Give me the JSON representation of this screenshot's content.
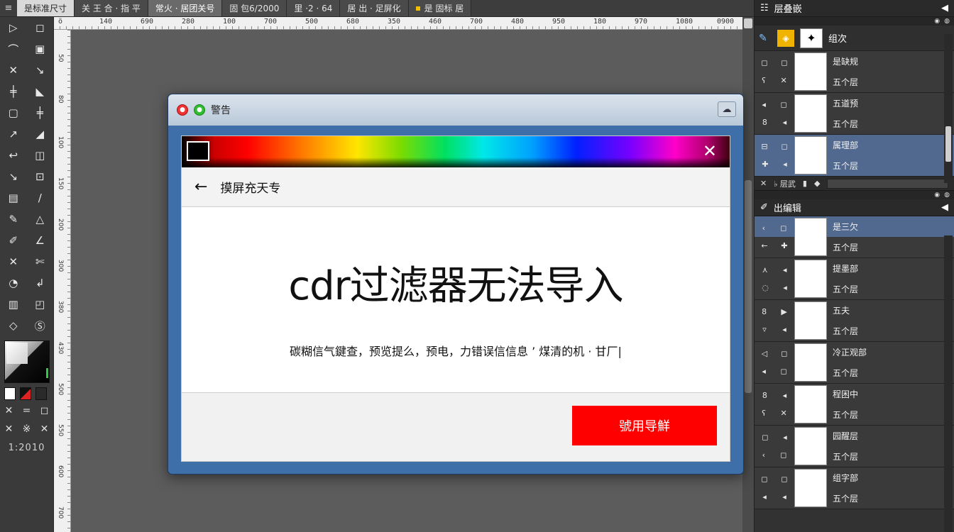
{
  "tabs": {
    "menu_icon": "≡",
    "items": [
      {
        "label": "是标准尺寸",
        "state": "first"
      },
      {
        "label": "关 王  合  ·  指 平",
        "state": "normal"
      },
      {
        "label": "常火  ·  居团关号",
        "state": "active"
      },
      {
        "label": "固 包6/2000",
        "state": "normal"
      },
      {
        "label": "里 ·2  ·  64",
        "state": "normal"
      },
      {
        "label": "居 出 ·  足屏化",
        "state": "normal"
      },
      {
        "label": "是 固标  居",
        "state": "dot"
      }
    ]
  },
  "ruler": {
    "top_labels": [
      "ö",
      "140",
      "690",
      "280",
      "100",
      "700",
      "500",
      "680",
      "350",
      "460",
      "700",
      "480",
      "950",
      "180",
      "970",
      "1080",
      "0900"
    ],
    "left_labels": [
      "50",
      "80",
      "100",
      "150",
      "200",
      "300",
      "380",
      "430",
      "500",
      "550",
      "600",
      "700"
    ]
  },
  "toolbox": {
    "tools": [
      [
        "▷",
        "◻"
      ],
      [
        "⌒",
        "▣"
      ],
      [
        "✕",
        "↘"
      ],
      [
        "╪",
        "◣"
      ],
      [
        "▢",
        "╪"
      ],
      [
        "↗",
        "◢"
      ],
      [
        "↩",
        "◫"
      ],
      [
        "↘",
        "⊡"
      ],
      [
        "▤",
        "∕"
      ],
      [
        "✎",
        "△"
      ],
      [
        "✐",
        "∠"
      ],
      [
        "✕",
        "✄"
      ],
      [
        "◔",
        "↲"
      ],
      [
        "▥",
        "◰"
      ],
      [
        "◇",
        "Ⓢ"
      ]
    ],
    "small_row_1": [
      "✕",
      "=",
      "◻"
    ],
    "small_row_2": [
      "✕",
      "※",
      "✕"
    ],
    "readout": "1:2010"
  },
  "dialog": {
    "title": "警告",
    "help_icon": "☁",
    "close_glyph": "✕",
    "back_glyph": "←",
    "nav_title": "摸屏充天专",
    "headline": "cdr过滤器无法导入",
    "message": "碳糊信气鍵查，预览提么，预电，力错误信信息  ’  煤清的机 · 甘厂|",
    "action_label": "號用导鮮"
  },
  "panels": {
    "layers_title": "层叠嵌",
    "channels_title": "出编辑",
    "top_layer_label": "组次",
    "layers": [
      {
        "labels": [
          "是缺规",
          "五个层"
        ],
        "ctrls": [
          [
            "◻",
            "◻"
          ],
          [
            "ʕ",
            "✕"
          ]
        ],
        "selected": false
      },
      {
        "labels": [
          "五道预",
          "五个层"
        ],
        "ctrls": [
          [
            "◂",
            "◻"
          ],
          [
            "8",
            "◂"
          ]
        ],
        "selected": false
      },
      {
        "labels": [
          "属理部",
          "五个层"
        ],
        "ctrls": [
          [
            "⊟",
            "◻"
          ],
          [
            "✚",
            "◂"
          ]
        ],
        "selected": true
      }
    ],
    "toolbar": [
      "✕",
      "♭ 层武",
      "▮",
      "◆"
    ],
    "channels": [
      {
        "labels": [
          "是三欠",
          "五个层"
        ],
        "ctrls": [
          [
            "‹",
            "◻"
          ],
          [
            "←",
            "✚"
          ]
        ],
        "half": true
      },
      {
        "labels": [
          "提墨部",
          "五个层"
        ],
        "ctrls": [
          [
            "⋏",
            "◂"
          ],
          [
            "◌",
            "◂"
          ]
        ],
        "half": false
      },
      {
        "labels": [
          "五夫",
          "五个层"
        ],
        "ctrls": [
          [
            "8",
            "▶"
          ],
          [
            "▿",
            "◂"
          ]
        ],
        "half": false
      },
      {
        "labels": [
          "冷正观部",
          "五个层"
        ],
        "ctrls": [
          [
            "◁",
            "◻"
          ],
          [
            "◂",
            "◻"
          ]
        ],
        "half": false
      },
      {
        "labels": [
          "程困中",
          "五个层"
        ],
        "ctrls": [
          [
            "8",
            "◂"
          ],
          [
            "ʕ",
            "✕"
          ]
        ],
        "half": false
      },
      {
        "labels": [
          "园醒层",
          "五个层"
        ],
        "ctrls": [
          [
            "◻",
            "◂"
          ],
          [
            "‹",
            "◻"
          ]
        ],
        "half": false
      },
      {
        "labels": [
          "组字部",
          "五个层"
        ],
        "ctrls": [
          [
            "◻",
            "◻"
          ],
          [
            "◂",
            "◂"
          ]
        ],
        "half": false
      }
    ]
  },
  "colors": {
    "accent_red": "#ff0000",
    "dialog_frame": "#3f6fa8",
    "selection": "#52698f"
  }
}
